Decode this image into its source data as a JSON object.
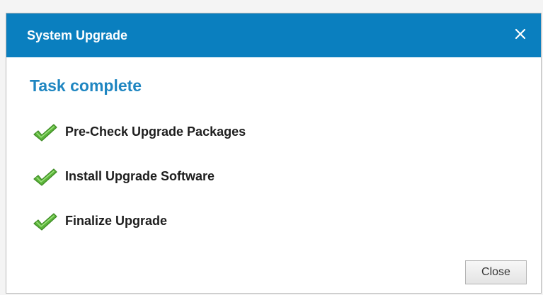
{
  "dialog": {
    "title": "System Upgrade",
    "close_icon": "close-icon",
    "heading": "Task complete",
    "tasks": [
      {
        "label": "Pre-Check Upgrade Packages",
        "status": "complete",
        "icon": "check-icon"
      },
      {
        "label": "Install Upgrade Software",
        "status": "complete",
        "icon": "check-icon"
      },
      {
        "label": "Finalize Upgrade",
        "status": "complete",
        "icon": "check-icon"
      }
    ],
    "close_button_label": "Close"
  },
  "colors": {
    "titlebar": "#0a7fbf",
    "heading": "#1f86c1",
    "check": "#5cb43a",
    "task_text": "#1e1e1e"
  }
}
